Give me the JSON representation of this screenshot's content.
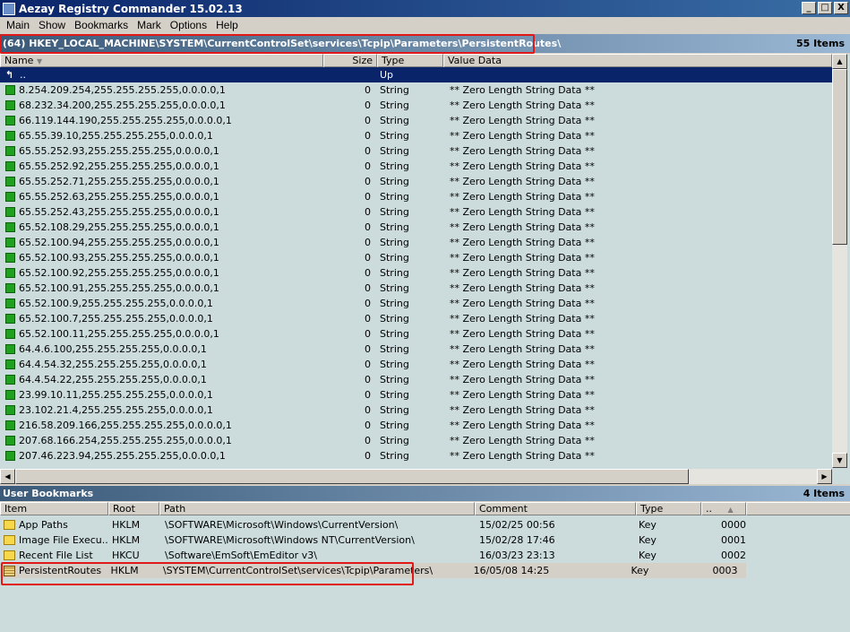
{
  "window": {
    "title": "Aezay Registry Commander 15.02.13",
    "controls": [
      "_",
      "□",
      "X"
    ]
  },
  "menu": [
    "Main",
    "Show",
    "Bookmarks",
    "Mark",
    "Options",
    "Help"
  ],
  "path_bar": {
    "path": "(64) HKEY_LOCAL_MACHINE\\SYSTEM\\CurrentControlSet\\services\\Tcpip\\Parameters\\PersistentRoutes\\",
    "count": "55 Items"
  },
  "columns": {
    "name": "Name",
    "size": "Size",
    "type": "Type",
    "value": "Value Data"
  },
  "up_row": {
    "name": "..",
    "type": "Up"
  },
  "rows": [
    {
      "name": "8.254.209.254,255.255.255.255,0.0.0.0,1",
      "size": "0",
      "type": "String",
      "value": "** Zero Length String Data **"
    },
    {
      "name": "68.232.34.200,255.255.255.255,0.0.0.0,1",
      "size": "0",
      "type": "String",
      "value": "** Zero Length String Data **"
    },
    {
      "name": "66.119.144.190,255.255.255.255,0.0.0.0,1",
      "size": "0",
      "type": "String",
      "value": "** Zero Length String Data **"
    },
    {
      "name": "65.55.39.10,255.255.255.255,0.0.0.0,1",
      "size": "0",
      "type": "String",
      "value": "** Zero Length String Data **"
    },
    {
      "name": "65.55.252.93,255.255.255.255,0.0.0.0,1",
      "size": "0",
      "type": "String",
      "value": "** Zero Length String Data **"
    },
    {
      "name": "65.55.252.92,255.255.255.255,0.0.0.0,1",
      "size": "0",
      "type": "String",
      "value": "** Zero Length String Data **"
    },
    {
      "name": "65.55.252.71,255.255.255.255,0.0.0.0,1",
      "size": "0",
      "type": "String",
      "value": "** Zero Length String Data **"
    },
    {
      "name": "65.55.252.63,255.255.255.255,0.0.0.0,1",
      "size": "0",
      "type": "String",
      "value": "** Zero Length String Data **"
    },
    {
      "name": "65.55.252.43,255.255.255.255,0.0.0.0,1",
      "size": "0",
      "type": "String",
      "value": "** Zero Length String Data **"
    },
    {
      "name": "65.52.108.29,255.255.255.255,0.0.0.0,1",
      "size": "0",
      "type": "String",
      "value": "** Zero Length String Data **"
    },
    {
      "name": "65.52.100.94,255.255.255.255,0.0.0.0,1",
      "size": "0",
      "type": "String",
      "value": "** Zero Length String Data **"
    },
    {
      "name": "65.52.100.93,255.255.255.255,0.0.0.0,1",
      "size": "0",
      "type": "String",
      "value": "** Zero Length String Data **"
    },
    {
      "name": "65.52.100.92,255.255.255.255,0.0.0.0,1",
      "size": "0",
      "type": "String",
      "value": "** Zero Length String Data **"
    },
    {
      "name": "65.52.100.91,255.255.255.255,0.0.0.0,1",
      "size": "0",
      "type": "String",
      "value": "** Zero Length String Data **"
    },
    {
      "name": "65.52.100.9,255.255.255.255,0.0.0.0,1",
      "size": "0",
      "type": "String",
      "value": "** Zero Length String Data **"
    },
    {
      "name": "65.52.100.7,255.255.255.255,0.0.0.0,1",
      "size": "0",
      "type": "String",
      "value": "** Zero Length String Data **"
    },
    {
      "name": "65.52.100.11,255.255.255.255,0.0.0.0,1",
      "size": "0",
      "type": "String",
      "value": "** Zero Length String Data **"
    },
    {
      "name": "64.4.6.100,255.255.255.255,0.0.0.0,1",
      "size": "0",
      "type": "String",
      "value": "** Zero Length String Data **"
    },
    {
      "name": "64.4.54.32,255.255.255.255,0.0.0.0,1",
      "size": "0",
      "type": "String",
      "value": "** Zero Length String Data **"
    },
    {
      "name": "64.4.54.22,255.255.255.255,0.0.0.0,1",
      "size": "0",
      "type": "String",
      "value": "** Zero Length String Data **"
    },
    {
      "name": "23.99.10.11,255.255.255.255,0.0.0.0,1",
      "size": "0",
      "type": "String",
      "value": "** Zero Length String Data **"
    },
    {
      "name": "23.102.21.4,255.255.255.255,0.0.0.0,1",
      "size": "0",
      "type": "String",
      "value": "** Zero Length String Data **"
    },
    {
      "name": "216.58.209.166,255.255.255.255,0.0.0.0,1",
      "size": "0",
      "type": "String",
      "value": "** Zero Length String Data **"
    },
    {
      "name": "207.68.166.254,255.255.255.255,0.0.0.0,1",
      "size": "0",
      "type": "String",
      "value": "** Zero Length String Data **"
    },
    {
      "name": "207.46.223.94,255.255.255.255,0.0.0.0,1",
      "size": "0",
      "type": "String",
      "value": "** Zero Length String Data **"
    }
  ],
  "bookmarks": {
    "title": "User Bookmarks",
    "count": "4 Items",
    "columns": {
      "item": "Item",
      "root": "Root",
      "path": "Path",
      "comment": "Comment",
      "type": "Type",
      "num": ".."
    },
    "rows": [
      {
        "item": "App Paths",
        "root": "HKLM",
        "path": "\\SOFTWARE\\Microsoft\\Windows\\CurrentVersion\\",
        "comment": "15/02/25 00:56",
        "type": "Key",
        "num": "0000",
        "icon": "folder-icon"
      },
      {
        "item": "Image File Execu...",
        "root": "HKLM",
        "path": "\\SOFTWARE\\Microsoft\\Windows NT\\CurrentVersion\\",
        "comment": "15/02/28 17:46",
        "type": "Key",
        "num": "0001",
        "icon": "folder-icon"
      },
      {
        "item": "Recent File List",
        "root": "HKCU",
        "path": "\\Software\\EmSoft\\EmEditor v3\\",
        "comment": "16/03/23 23:13",
        "type": "Key",
        "num": "0002",
        "icon": "folder-icon"
      },
      {
        "item": "PersistentRoutes",
        "root": "HKLM",
        "path": "\\SYSTEM\\CurrentControlSet\\services\\Tcpip\\Parameters\\",
        "comment": "16/05/08 14:25",
        "type": "Key",
        "num": "0003",
        "icon": "registry-file-icon"
      }
    ]
  },
  "colors": {
    "title_gradient_start": "#0a246a",
    "header_gradient_start": "#3b5a7a",
    "list_bg": "#ccdcdc",
    "selection": "#0a246a",
    "string_icon": "#1fa01f",
    "highlight_box": "#e01818"
  }
}
